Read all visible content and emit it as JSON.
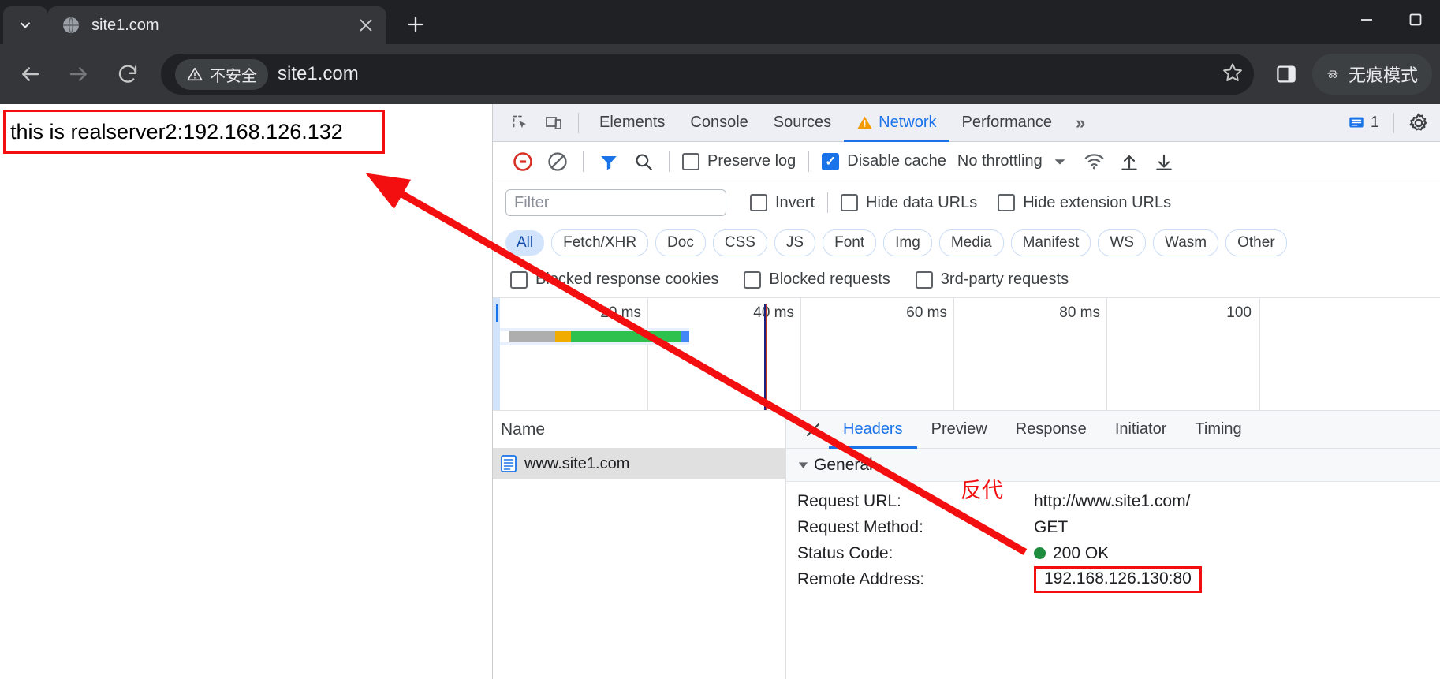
{
  "browser": {
    "tab": {
      "title": "site1.com",
      "favicon_icon": "globe-icon",
      "close_icon": "close-icon"
    },
    "tab_list_icon": "chevron-down-icon",
    "new_tab_icon": "plus-icon",
    "window_controls": {
      "minimize_icon": "minimize-icon",
      "maximize_icon": "maximize-icon"
    },
    "nav": {
      "back_icon": "arrow-left-icon",
      "forward_icon": "arrow-right-icon",
      "reload_icon": "reload-icon"
    },
    "omnibox": {
      "security_icon": "warning-triangle-icon",
      "security_label": "不安全",
      "url": "site1.com",
      "bookmark_icon": "star-icon"
    },
    "side_panel_icon": "side-panel-icon",
    "incognito": {
      "icon": "incognito-icon",
      "label": "无痕模式"
    }
  },
  "page": {
    "body_text": "this is realserver2:192.168.126.132",
    "highlight_color": "#f30f0f"
  },
  "devtools": {
    "inspect_icon": "inspect-element-icon",
    "device_icon": "device-toolbar-icon",
    "panels": [
      {
        "label": "Elements",
        "active": false
      },
      {
        "label": "Console",
        "active": false
      },
      {
        "label": "Sources",
        "active": false
      },
      {
        "label": "Network",
        "active": true,
        "warn_icon": "warning-triangle-icon"
      },
      {
        "label": "Performance",
        "active": false
      }
    ],
    "more_panels_icon": "chevrons-right-icon",
    "messages": {
      "icon": "message-icon",
      "count": "1"
    },
    "settings_icon": "gear-icon",
    "toolbar": {
      "record_icon": "record-stop-icon",
      "clear_icon": "clear-icon",
      "filter_icon": "filter-icon",
      "search_icon": "search-icon",
      "preserve_log": {
        "label": "Preserve log",
        "checked": false
      },
      "disable_cache": {
        "label": "Disable cache",
        "checked": true
      },
      "throttling": {
        "label": "No throttling",
        "caret_icon": "chevron-down-icon"
      },
      "wifi_icon": "wifi-icon",
      "import_icon": "upload-icon",
      "export_icon": "download-icon"
    },
    "filterbar": {
      "filter_placeholder": "Filter",
      "filter_value": "",
      "invert": {
        "label": "Invert",
        "checked": false
      },
      "hide_data_urls": {
        "label": "Hide data URLs",
        "checked": false
      },
      "hide_extension_urls": {
        "label": "Hide extension URLs",
        "checked": false
      }
    },
    "type_filters": [
      {
        "label": "All",
        "active": true
      },
      {
        "label": "Fetch/XHR",
        "active": false
      },
      {
        "label": "Doc",
        "active": false
      },
      {
        "label": "CSS",
        "active": false
      },
      {
        "label": "JS",
        "active": false
      },
      {
        "label": "Font",
        "active": false
      },
      {
        "label": "Img",
        "active": false
      },
      {
        "label": "Media",
        "active": false
      },
      {
        "label": "Manifest",
        "active": false
      },
      {
        "label": "WS",
        "active": false
      },
      {
        "label": "Wasm",
        "active": false
      },
      {
        "label": "Other",
        "active": false
      }
    ],
    "extra_filters": [
      {
        "label": "Blocked response cookies",
        "checked": false
      },
      {
        "label": "Blocked requests",
        "checked": false
      },
      {
        "label": "3rd-party requests",
        "checked": false
      }
    ],
    "overview": {
      "ticks": [
        "20 ms",
        "40 ms",
        "60 ms",
        "80 ms",
        "100"
      ],
      "bar_segments": [
        {
          "name": "queueing",
          "color": "#ffffff"
        },
        {
          "name": "stalled",
          "color": "#aeaeae"
        },
        {
          "name": "waiting",
          "color": "#f0ad00"
        },
        {
          "name": "content-download",
          "color": "#2ec14e"
        },
        {
          "name": "finish",
          "color": "#4285f4"
        }
      ],
      "dom_content_loaded_color": "#1a237e",
      "load_event_color": "#c0392b"
    },
    "request_table": {
      "columns": [
        "Name"
      ],
      "rows": [
        {
          "name": "www.site1.com",
          "icon": "document-icon",
          "selected": true
        }
      ]
    },
    "detail": {
      "close_icon": "close-icon",
      "tabs": [
        {
          "label": "Headers",
          "active": true
        },
        {
          "label": "Preview",
          "active": false
        },
        {
          "label": "Response",
          "active": false
        },
        {
          "label": "Initiator",
          "active": false
        },
        {
          "label": "Timing",
          "active": false
        }
      ],
      "section_title": "General",
      "section_caret_icon": "triangle-down-icon",
      "headers": [
        {
          "key": "Request URL:",
          "value": "http://www.site1.com/",
          "status_dot": false,
          "boxed": false
        },
        {
          "key": "Request Method:",
          "value": "GET",
          "status_dot": false,
          "boxed": false
        },
        {
          "key": "Status Code:",
          "value": "200 OK",
          "status_dot": true,
          "boxed": false
        },
        {
          "key": "Remote Address:",
          "value": "192.168.126.130:80",
          "status_dot": false,
          "boxed": true
        }
      ]
    }
  },
  "annotations": {
    "arrow_color": "#f30f0f",
    "label": "反代"
  }
}
